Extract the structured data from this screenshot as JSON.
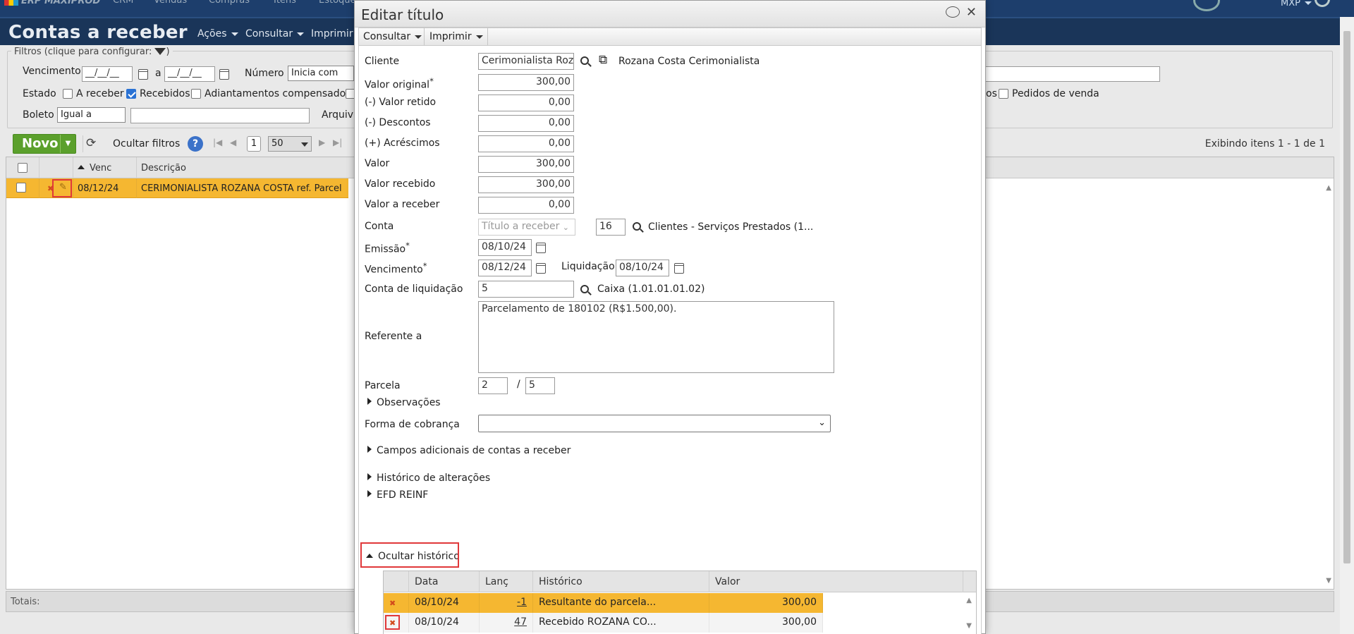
{
  "app": {
    "logo": "ERP MAXIPROD",
    "top_menu": [
      "CRM",
      "Vendas",
      "Compras",
      "Itens",
      "Estoque"
    ],
    "user": "MXP",
    "page_title": "Contas a receber",
    "title_menu": [
      "Ações",
      "Consultar",
      "Imprimir"
    ]
  },
  "filters": {
    "legend": "Filtros (clique para configurar:",
    "legend_close": ")",
    "vencimento_label": "Vencimento",
    "date_placeholder": "__/__/__",
    "a_label": "a",
    "numero_label": "Número",
    "numero_mode": "Inicia com",
    "estado_label": "Estado",
    "estados": [
      {
        "label": "A receber",
        "checked": false
      },
      {
        "label": "Recebidos",
        "checked": true
      },
      {
        "label": "Adiantamentos compensados",
        "checked": false
      }
    ],
    "estado_hidden_suffix": "os",
    "pedidos_label": "Pedidos de venda",
    "pedidos_checked": false,
    "boleto_label": "Boleto",
    "boleto_mode": "Igual a",
    "arquivo_label": "Arquiv"
  },
  "toolbar": {
    "novo_label": "Novo",
    "ocultar_filtros_label": "Ocultar filtros",
    "page": "1",
    "page_size": "50",
    "display_info": "Exibindo itens 1 - 1 de 1"
  },
  "grid": {
    "columns": [
      "Venc",
      "Descrição"
    ],
    "rows": [
      {
        "venc": "08/12/24",
        "descricao": "CERIMONIALISTA ROZANA COSTA ref. Parcel"
      }
    ],
    "totals_label": "Totais:"
  },
  "modal": {
    "title": "Editar título",
    "menu": [
      "Consultar",
      "Imprimir"
    ],
    "fields": {
      "cliente_label": "Cliente",
      "cliente_value": "Cerimonialista Roza",
      "cliente_name": "Rozana Costa Cerimonialista",
      "valor_original_label": "Valor original",
      "valor_original": "300,00",
      "valor_retido_label": "(-) Valor retido",
      "valor_retido": "0,00",
      "descontos_label": "(-) Descontos",
      "descontos": "0,00",
      "acrescimos_label": "(+) Acréscimos",
      "acrescimos": "0,00",
      "valor_label": "Valor",
      "valor": "300,00",
      "valor_recebido_label": "Valor recebido",
      "valor_recebido": "300,00",
      "valor_a_receber_label": "Valor a receber",
      "valor_a_receber": "0,00",
      "conta_label": "Conta",
      "conta_tipo": "Título a receber",
      "conta_numero": "16",
      "conta_desc": "Clientes - Serviços Prestados (1...",
      "emissao_label": "Emissão",
      "emissao": "08/10/24",
      "vencimento_label": "Vencimento",
      "vencimento": "08/12/24",
      "liquidacao_label": "Liquidação",
      "liquidacao": "08/10/24",
      "conta_liq_label": "Conta de liquidação",
      "conta_liq": "5",
      "conta_liq_desc": "Caixa (1.01.01.01.02)",
      "referente_label": "Referente a",
      "referente": "Parcelamento de 180102 (R$1.500,00).",
      "parcela_label": "Parcela",
      "parcela": "2",
      "parcela_sep": "/",
      "parcela_total": "5",
      "observacoes_label": "Observações",
      "forma_cobranca_label": "Forma de cobrança",
      "forma_cobranca": "",
      "campos_adicionais_label": "Campos adicionais de contas a receber",
      "historico_alteracoes_label": "Histórico de alterações",
      "efd_label": "EFD REINF",
      "ocultar_historico_label": "Ocultar histórico",
      "required_mark": "*"
    },
    "history": {
      "columns": [
        "Data",
        "Lanç",
        "Histórico",
        "Valor"
      ],
      "rows": [
        {
          "data": "08/10/24",
          "lanc": "-1",
          "historico": "Resultante do parcela...",
          "valor": "300,00",
          "highlight": true
        },
        {
          "data": "08/10/24",
          "lanc": "47",
          "historico": "Recebido ROZANA CO...",
          "valor": "300,00",
          "highlight": false
        }
      ]
    }
  },
  "colors": {
    "nav_dark": "#1a3559",
    "novo_green": "#5ba02c",
    "row_highlight": "#f5b731",
    "annotation_red": "#e0383a"
  }
}
